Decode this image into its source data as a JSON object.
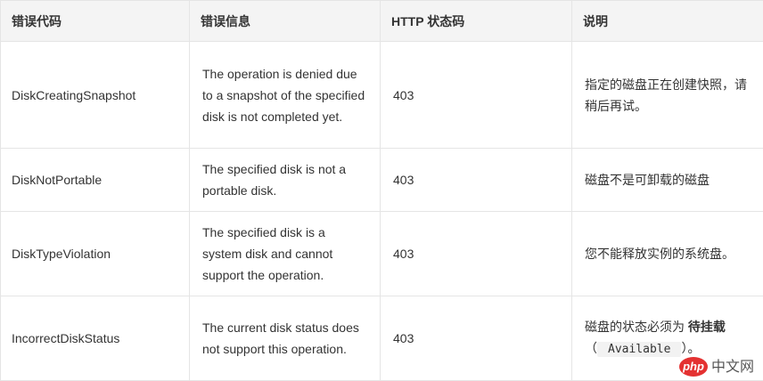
{
  "table": {
    "headers": [
      "错误代码",
      "错误信息",
      "HTTP 状态码",
      "说明"
    ],
    "rows": [
      {
        "code": "DiskCreatingSnapshot",
        "message": "The operation is denied due to a snapshot of the specified disk is not completed yet.",
        "status": "403",
        "description": "指定的磁盘正在创建快照，请稍后再试。"
      },
      {
        "code": "DiskNotPortable",
        "message": "The specified disk is not a portable disk.",
        "status": "403",
        "description": "磁盘不是可卸载的磁盘"
      },
      {
        "code": "DiskTypeViolation",
        "message": "The specified disk is a system disk and cannot support the operation.",
        "status": "403",
        "description": "您不能释放实例的系统盘。"
      },
      {
        "code": "IncorrectDiskStatus",
        "message": "The current disk status does not support this operation.",
        "status": "403",
        "description_prefix": "磁盘的状态必须为",
        "description_bold": "待挂载",
        "description_paren_open": "（",
        "description_code": "Available",
        "description_paren_close": "）。"
      }
    ]
  },
  "watermark": {
    "badge": "php",
    "text": "中文网"
  }
}
